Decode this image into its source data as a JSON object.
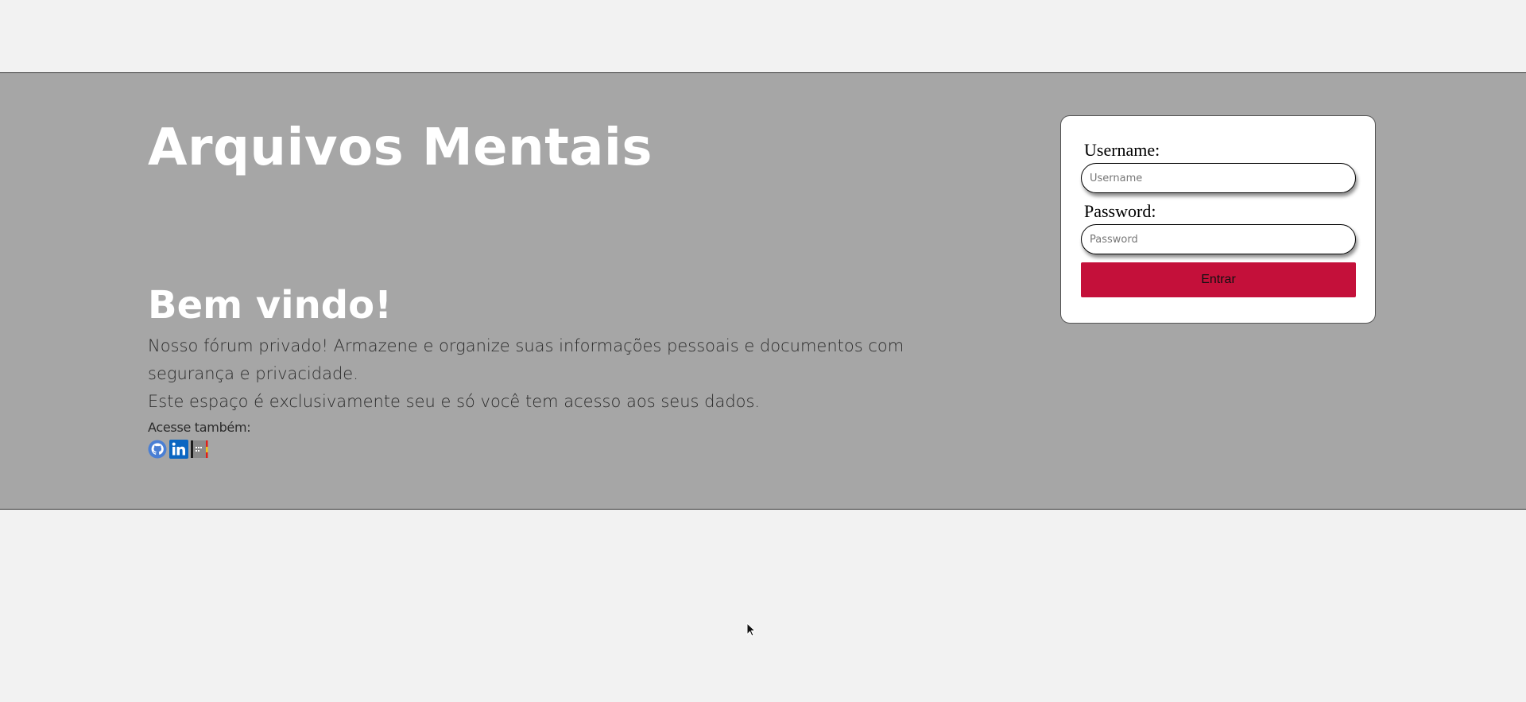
{
  "hero": {
    "site_title": "Arquivos Mentais",
    "welcome_heading": "Bem vindo!",
    "description_line1": "Nosso fórum privado! Armazene e organize suas informações pessoais e documentos com segurança e privacidade.",
    "description_line2": "Este espaço é exclusivamente seu e só você tem acesso aos seus dados.",
    "also_label": "Acesse também:",
    "links": [
      {
        "icon": "github-icon"
      },
      {
        "icon": "linkedin-icon"
      },
      {
        "icon": "portfolio-icon"
      }
    ]
  },
  "login": {
    "username_label": "Username:",
    "username_placeholder": "Username",
    "username_value": "",
    "password_label": "Password:",
    "password_placeholder": "Password",
    "password_value": "",
    "submit_label": "Entrar"
  },
  "colors": {
    "page_background": "#f2f2f2",
    "band_background": "#a6a6a6",
    "button_background": "#c4103a",
    "github": "#4a7fd4",
    "linkedin": "#0a66c2"
  }
}
